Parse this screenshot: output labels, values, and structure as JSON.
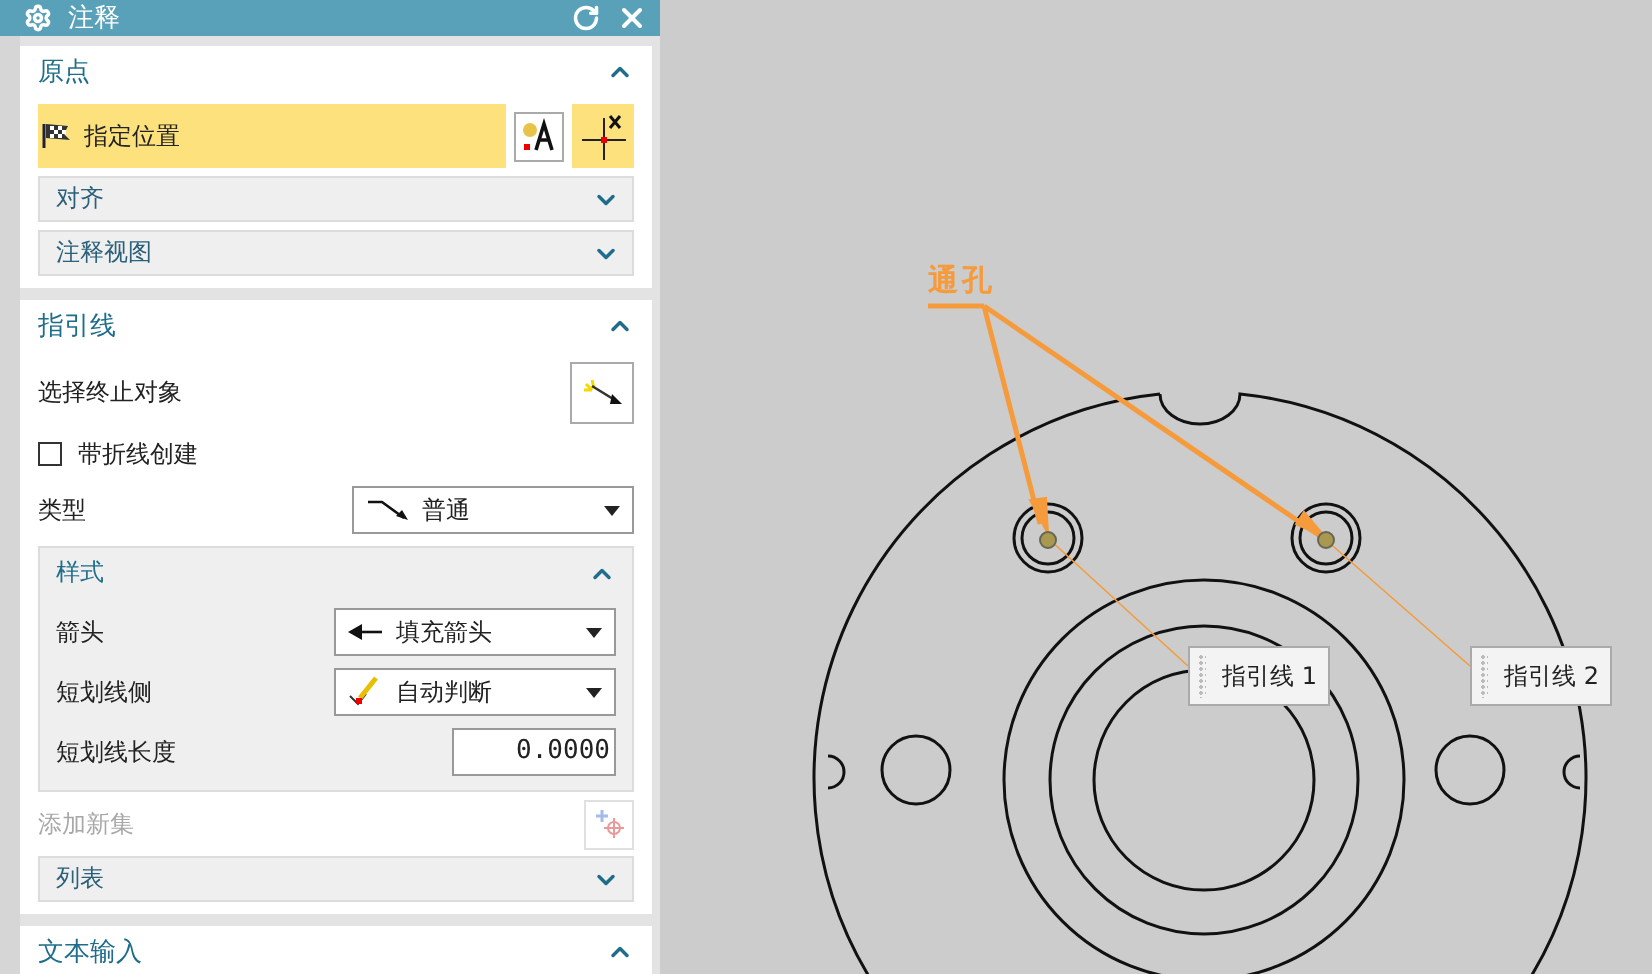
{
  "dialog": {
    "title": "注释"
  },
  "origin": {
    "title": "原点",
    "expanded": true,
    "specify_location": {
      "label": "指定位置",
      "selected": true
    },
    "subsections": [
      {
        "title": "对齐",
        "expanded": false
      },
      {
        "title": "注释视图",
        "expanded": false
      }
    ]
  },
  "leader": {
    "title": "指引线",
    "expanded": true,
    "select_end_object": "选择终止对象",
    "jog_checkbox": {
      "label": "带折线创建",
      "checked": false
    },
    "type": {
      "label": "类型",
      "value": "普通"
    },
    "style": {
      "title": "样式",
      "expanded": true,
      "rows": [
        {
          "label": "箭头",
          "kind": "dropdown",
          "value": "填充箭头"
        },
        {
          "label": "短划线侧",
          "kind": "dropdown",
          "value": "自动判断"
        },
        {
          "label": "短划线长度",
          "kind": "number",
          "value": "0.0000"
        }
      ]
    },
    "add_new_set": {
      "label": "添加新集",
      "disabled": true
    },
    "list": {
      "title": "列表",
      "expanded": false
    }
  },
  "text_input": {
    "title": "文本输入",
    "expanded": true
  },
  "canvas": {
    "annotation": "通孔",
    "leader_labels": [
      "指引线 1",
      "指引线 2"
    ]
  }
}
